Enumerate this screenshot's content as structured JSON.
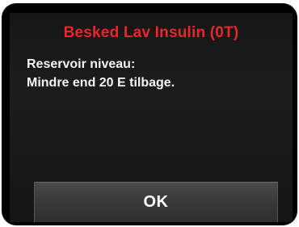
{
  "alert": {
    "title": "Besked Lav Insulin (0T)",
    "message_lines": [
      "Reservoir niveau:",
      "Mindre end 20 E tilbage."
    ]
  },
  "buttons": {
    "ok_label": "OK"
  },
  "colors": {
    "title": "#e8262c",
    "text": "#f4f4f4",
    "background": "#1a1a1a",
    "button": "#3a3a3a"
  }
}
